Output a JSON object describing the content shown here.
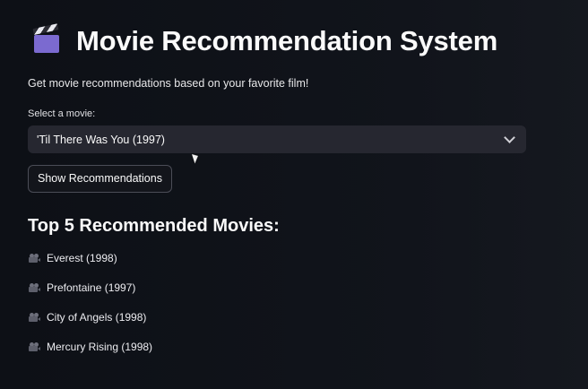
{
  "header": {
    "title": "Movie Recommendation System",
    "title_icon": "clapper-board-icon",
    "subtitle": "Get movie recommendations based on your favorite film!"
  },
  "movie_select": {
    "label": "Select a movie:",
    "value": "'Til There Was You (1997)",
    "icon": "chevron-down-icon"
  },
  "actions": {
    "show_label": "Show Recommendations"
  },
  "results": {
    "title": "Top 5 Recommended Movies:",
    "item_icon": "movie-camera-icon",
    "items": [
      "Everest (1998)",
      "Prefontaine (1997)",
      "City of Angels (1998)",
      "Mercury Rising (1998)"
    ]
  },
  "colors": {
    "background": "#0e1117",
    "select_bg": "#262730",
    "button_border": "#4b4d57",
    "text": "#fafafa"
  }
}
